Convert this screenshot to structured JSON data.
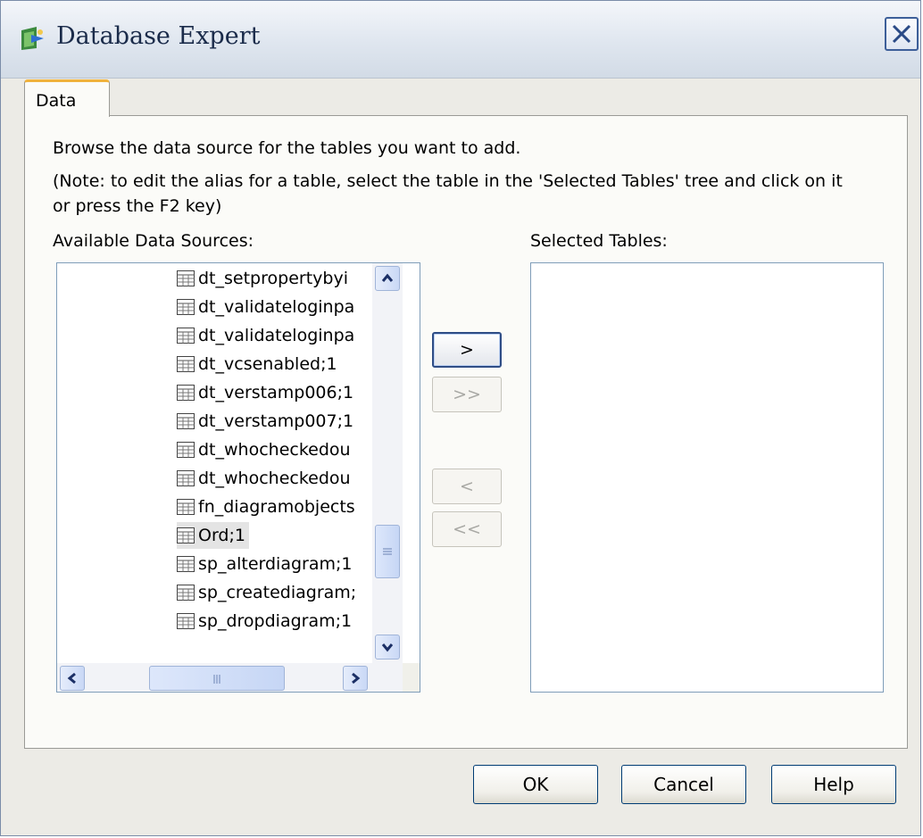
{
  "window": {
    "title": "Database Expert"
  },
  "tabs": [
    {
      "label": "Data"
    }
  ],
  "instructions": {
    "line1": "Browse the data source for the tables you want to add.",
    "line2": "(Note: to edit the alias for a table, select the table in the 'Selected Tables' tree and click on it",
    "line3": "or press the F2 key)"
  },
  "available": {
    "label": "Available Data Sources:",
    "items": [
      {
        "label": "dt_setpropertybyi"
      },
      {
        "label": "dt_validateloginpa"
      },
      {
        "label": "dt_validateloginpa"
      },
      {
        "label": "dt_vcsenabled;1"
      },
      {
        "label": "dt_verstamp006;1"
      },
      {
        "label": "dt_verstamp007;1"
      },
      {
        "label": "dt_whocheckedou"
      },
      {
        "label": "dt_whocheckedou"
      },
      {
        "label": "fn_diagramobjects"
      },
      {
        "label": "Ord;1",
        "selected": true
      },
      {
        "label": "sp_alterdiagram;1"
      },
      {
        "label": "sp_creatediagram;"
      },
      {
        "label": "sp_dropdiagram;1"
      }
    ]
  },
  "selected": {
    "label": "Selected Tables:"
  },
  "transfer": {
    "add": ">",
    "add_all": ">>",
    "remove": "<",
    "remove_all": "<<"
  },
  "buttons": {
    "ok": "OK",
    "cancel": "Cancel",
    "help": "Help"
  },
  "icons": {
    "window": "database-expert-icon",
    "close": "close-icon",
    "table": "table-icon"
  },
  "colors": {
    "titlebar": "#dfe6ef",
    "tab_accent": "#f0b23c",
    "button_border": "#003c74",
    "scrollbar": "#c9d8f6"
  }
}
